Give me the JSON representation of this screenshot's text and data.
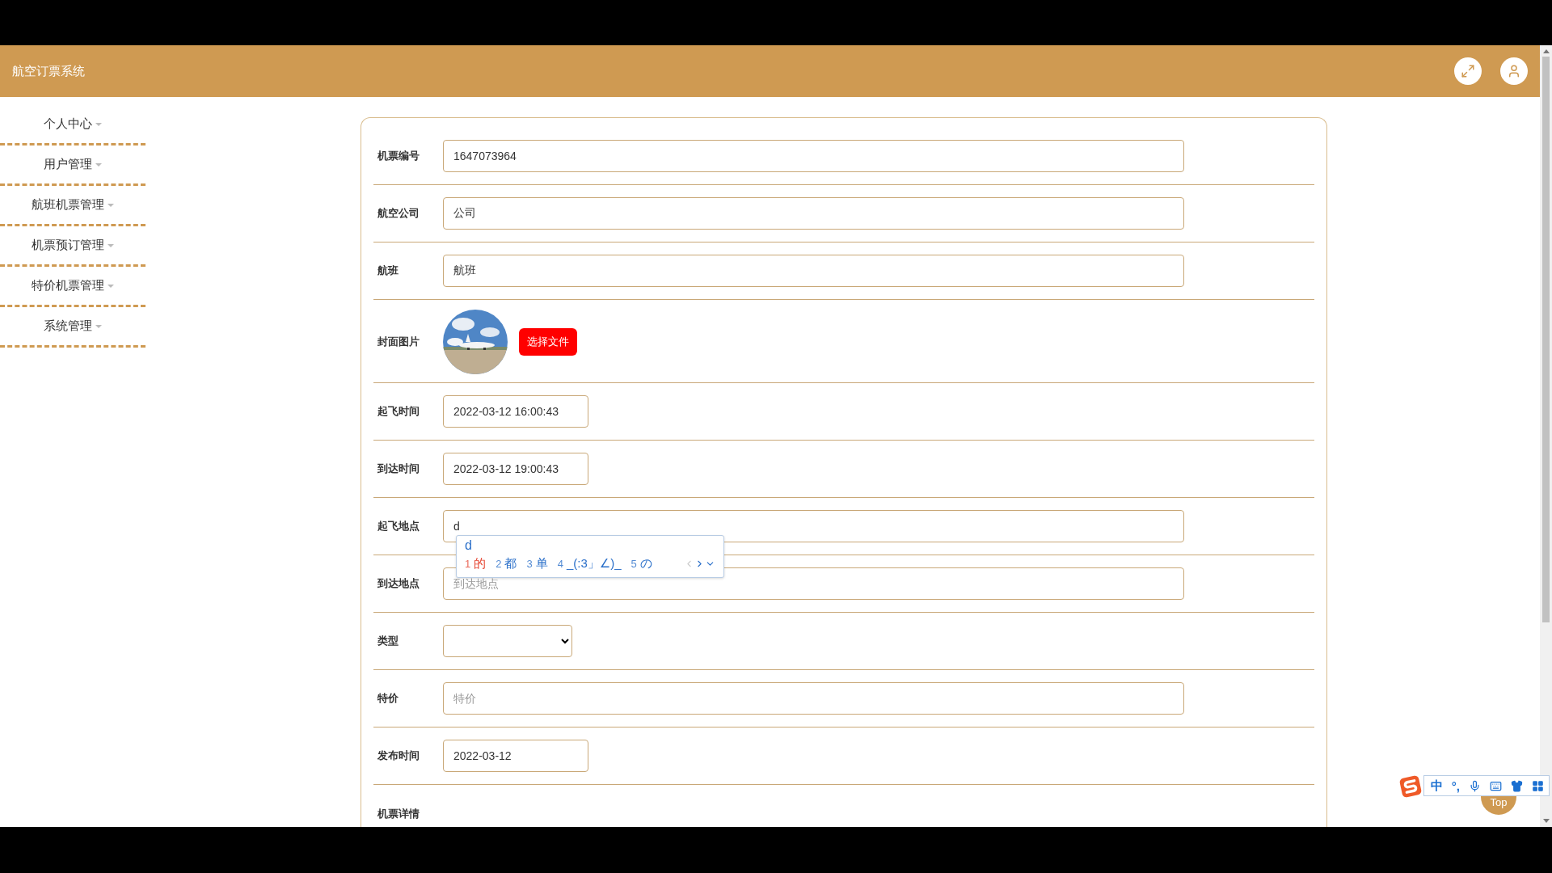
{
  "app": {
    "title": "航空订票系统"
  },
  "sidebar": {
    "items": [
      {
        "label": "个人中心"
      },
      {
        "label": "用户管理"
      },
      {
        "label": "航班机票管理"
      },
      {
        "label": "机票预订管理"
      },
      {
        "label": "特价机票管理"
      },
      {
        "label": "系统管理"
      }
    ]
  },
  "form": {
    "fields": [
      {
        "kind": "text",
        "label": "机票编号",
        "value": "1647073964"
      },
      {
        "kind": "text",
        "label": "航空公司",
        "value": "公司"
      },
      {
        "kind": "text",
        "label": "航班",
        "value": "航班"
      },
      {
        "label": "封面图片",
        "button": "选择文件"
      },
      {
        "kind": "date",
        "label": "起飞时间",
        "value": "2022-03-12 16:00:43"
      },
      {
        "kind": "date",
        "label": "到达时间",
        "value": "2022-03-12 19:00:43"
      },
      {
        "kind": "text",
        "label": "起飞地点",
        "value": "d",
        "composing": true
      },
      {
        "kind": "text",
        "label": "到达地点",
        "placeholder": "到达地点"
      },
      {
        "kind": "select",
        "label": "类型"
      },
      {
        "kind": "text",
        "label": "特价",
        "placeholder": "特价"
      },
      {
        "kind": "date",
        "label": "发布时间",
        "value": "2022-03-12"
      },
      {
        "kind": "heading",
        "label": "机票详情"
      }
    ]
  },
  "ime_popup": {
    "composition": "d",
    "candidates": [
      {
        "number": "1",
        "text": "的",
        "selected": true
      },
      {
        "number": "2",
        "text": "都",
        "selected": false
      },
      {
        "number": "3",
        "text": "单",
        "selected": false
      },
      {
        "number": "4",
        "text": "_(:3」∠)_",
        "selected": false
      },
      {
        "number": "5",
        "text": "の",
        "selected": false
      }
    ]
  },
  "ime_toolbar": {
    "mode": "中",
    "punctuation": "°,"
  },
  "back_to_top": {
    "label": "Top"
  }
}
